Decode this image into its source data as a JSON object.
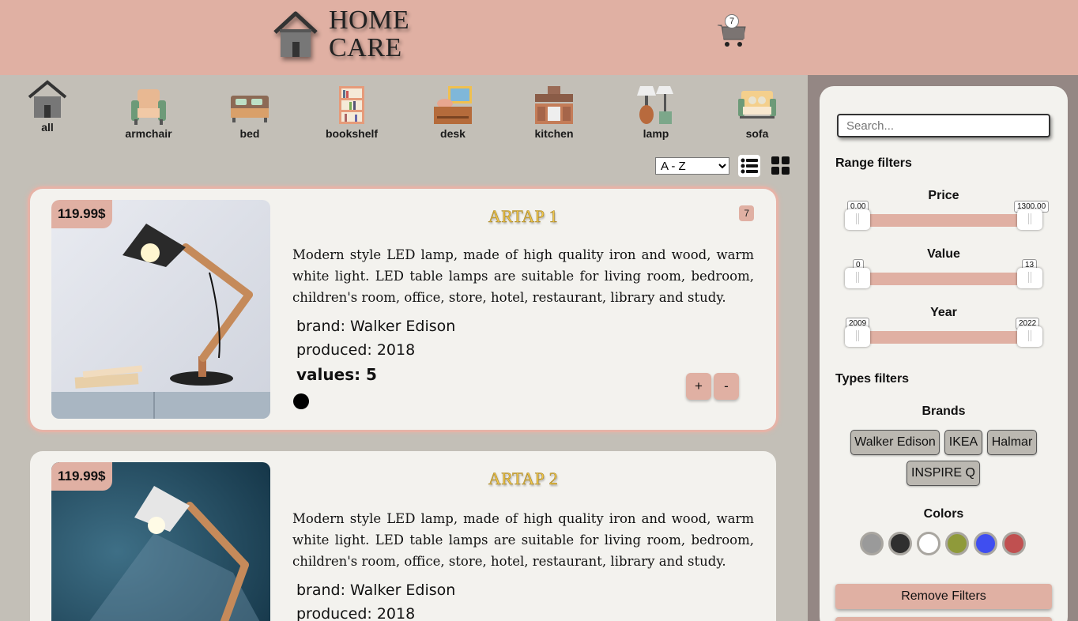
{
  "header": {
    "logo_line1": "HOME",
    "logo_line2": "CARE",
    "cart_count": "7"
  },
  "categories": [
    {
      "label": "all",
      "icon": "house-icon"
    },
    {
      "label": "armchair",
      "icon": "armchair-icon"
    },
    {
      "label": "bed",
      "icon": "bed-icon"
    },
    {
      "label": "bookshelf",
      "icon": "bookshelf-icon"
    },
    {
      "label": "desk",
      "icon": "desk-icon"
    },
    {
      "label": "kitchen",
      "icon": "kitchen-icon"
    },
    {
      "label": "lamp",
      "icon": "lamp-icon"
    },
    {
      "label": "sofa",
      "icon": "sofa-icon"
    }
  ],
  "toolbar": {
    "sort_selected": "A - Z",
    "sort_options": [
      "A - Z"
    ]
  },
  "products": [
    {
      "price": "119.99$",
      "title": "ARTAP 1",
      "stock": "7",
      "description": "Modern style LED lamp, made of high quality iron and wood, warm white light. LED table lamps are suitable for living room, bedroom, children's room, office, store, hotel, restaurant, library and study.",
      "brand": "brand: Walker Edison",
      "produced": "produced: 2018",
      "values": "values: 5",
      "color": "#000000",
      "plus": "+",
      "minus": "-"
    },
    {
      "price": "119.99$",
      "title": "ARTAP 2",
      "description": "Modern style LED lamp, made of high quality iron and wood, warm white light. LED table lamps are suitable for living room, bedroom, children's room, office, store, hotel, restaurant, library and study.",
      "brand": "brand: Walker Edison",
      "produced": "produced: 2018"
    }
  ],
  "sidebar": {
    "search_placeholder": "Search...",
    "range_title": "Range filters",
    "ranges": [
      {
        "label": "Price",
        "min": "0.00",
        "max": "1300.00"
      },
      {
        "label": "Value",
        "min": "0",
        "max": "13"
      },
      {
        "label": "Year",
        "min": "2009",
        "max": "2022"
      }
    ],
    "types_title": "Types filters",
    "brands_title": "Brands",
    "brands": [
      "Walker Edison",
      "IKEA",
      "Halmar",
      "INSPIRE Q"
    ],
    "colors_title": "Colors",
    "colors": [
      "#9a9a9a",
      "#2f2f2f",
      "#ffffff",
      "#8f9a3a",
      "#3f4ef0",
      "#c05050"
    ],
    "remove_filters": "Remove Filters"
  },
  "colors": {
    "header_bg": "#e0b0a3",
    "page_bg": "#c3bfb7",
    "card_bg": "#f3f2ee",
    "accent": "#e0b0a3"
  }
}
